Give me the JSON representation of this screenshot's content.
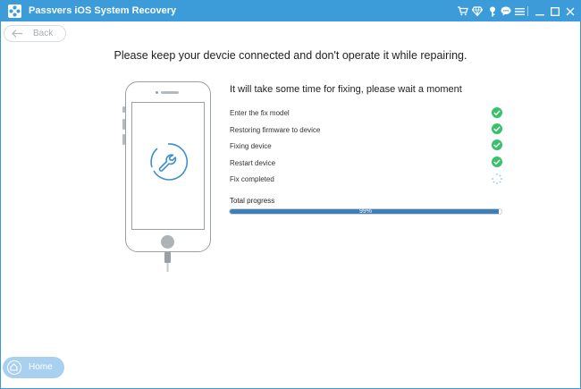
{
  "window": {
    "title": "Passvers iOS System Recovery"
  },
  "titlebar": {
    "icons": [
      "cart-icon",
      "diamond-icon",
      "key-icon",
      "chat-icon",
      "menu-icon",
      "minimize-icon",
      "maximize-icon",
      "close-icon"
    ]
  },
  "nav": {
    "back_label": "Back",
    "home_label": "Home"
  },
  "headline": "Please keep your devcie connected and don't operate it while repairing.",
  "status": {
    "title": "It will take some time for fixing, please wait a moment",
    "steps": [
      {
        "label": "Enter the fix model",
        "state": "done"
      },
      {
        "label": "Restoring firmware to device",
        "state": "done"
      },
      {
        "label": "Fixing device",
        "state": "done"
      },
      {
        "label": "Restart device",
        "state": "done"
      },
      {
        "label": "Fix completed",
        "state": "in-progress"
      }
    ]
  },
  "progress": {
    "label": "Total progress",
    "text": "99%",
    "value": 0.99
  },
  "colors": {
    "titlebar": "#3c9bd9",
    "check": "#3ac16c",
    "progress_fill": "#3d7fb8",
    "home_button": "#a9d1ef"
  }
}
